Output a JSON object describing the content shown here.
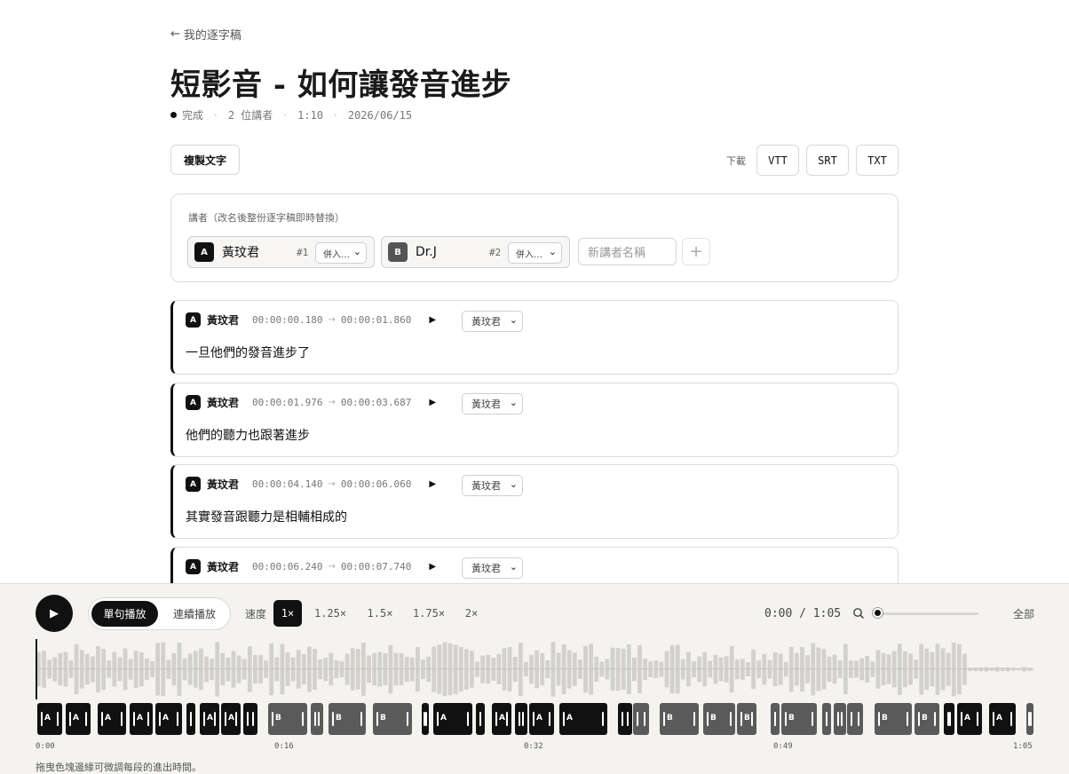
{
  "header": {
    "back_label": "我的逐字稿",
    "title": "短影音 - 如何讓發音進步",
    "status": "完成",
    "speaker_count": "2 位講者",
    "duration": "1:10",
    "date": "2026/06/15"
  },
  "toolbar": {
    "copy_label": "複製文字",
    "download_label": "下載",
    "formats": [
      "VTT",
      "SRT",
      "TXT"
    ]
  },
  "speakers": {
    "label": "講者（改名後整份逐字稿即時替換）",
    "items": [
      {
        "badge": "A",
        "name": "黃玟君",
        "num": "#1",
        "merge": "併入…"
      },
      {
        "badge": "B",
        "name": "Dr.J",
        "num": "#2",
        "merge": "併入…"
      }
    ],
    "new_placeholder": "新講者名稱",
    "add_icon": "plus-icon"
  },
  "segments": [
    {
      "badge": "A",
      "speaker": "黃玟君",
      "start": "00:00:00.180",
      "end": "00:00:01.860",
      "select": "黃玟君",
      "text": "一旦他們的發音進步了"
    },
    {
      "badge": "A",
      "speaker": "黃玟君",
      "start": "00:00:01.976",
      "end": "00:00:03.687",
      "select": "黃玟君",
      "text": "他們的聽力也跟著進步"
    },
    {
      "badge": "A",
      "speaker": "黃玟君",
      "start": "00:00:04.140",
      "end": "00:00:06.060",
      "select": "黃玟君",
      "text": "其實發音跟聽力是相輔相成的"
    },
    {
      "badge": "A",
      "speaker": "黃玟君",
      "start": "00:00:06.240",
      "end": "00:00:07.740",
      "select": "黃玟君",
      "text": ""
    }
  ],
  "player": {
    "play_icon": "play-icon",
    "mode_single": "單句播放",
    "mode_continuous": "連續播放",
    "speed_label": "速度",
    "speeds": [
      "1×",
      "1.25×",
      "1.5×",
      "1.75×",
      "2×"
    ],
    "speed_selected": "1×",
    "time": "0:00 / 1:05",
    "zoom_icon": "search-icon",
    "zoom_level": 0,
    "all_label": "全部",
    "ruler": [
      "0:00",
      "0:16",
      "0:32",
      "0:49",
      "1:05"
    ],
    "hint": "拖曳色塊邊緣可微調每段的進出時間。"
  },
  "colors": {
    "speaker_a": "#111111",
    "speaker_b": "#5a5a5a",
    "player_bg": "#f4f3f0"
  }
}
